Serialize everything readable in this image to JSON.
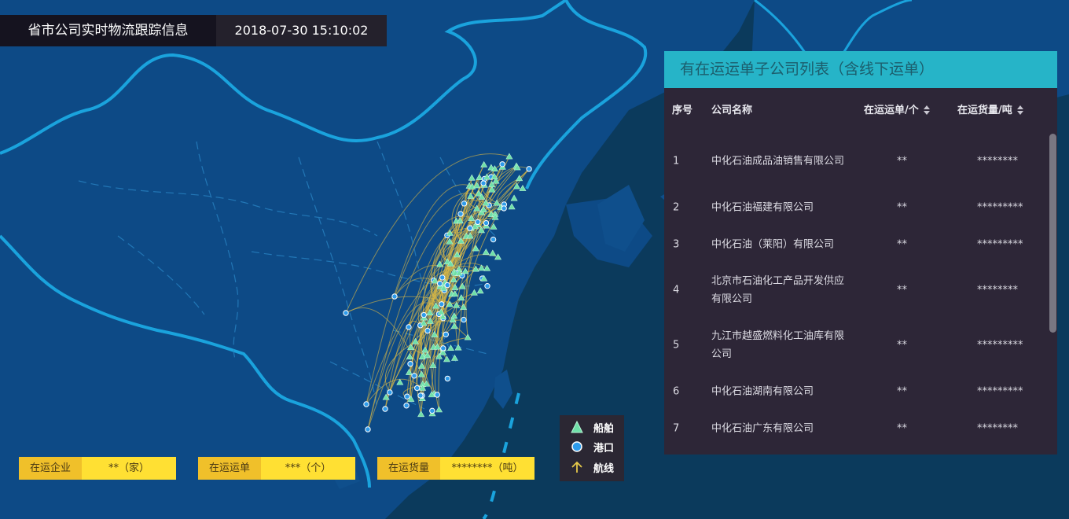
{
  "header": {
    "title": "省市公司实时物流跟踪信息",
    "datetime": "2018-07-30 15:10:02"
  },
  "panel": {
    "title": "有在运运单子公司列表（含线下运单）",
    "columns": {
      "index": "序号",
      "company": "公司名称",
      "orders": "在运运单/个",
      "volume": "在运货量/吨"
    },
    "rows": [
      {
        "index": "1",
        "company": "中化石油成品油销售有限公司",
        "orders": "**",
        "volume": "********"
      },
      {
        "index": "2",
        "company": "中化石油福建有限公司",
        "orders": "**",
        "volume": "*********"
      },
      {
        "index": "3",
        "company": "中化石油（莱阳）有限公司",
        "orders": "**",
        "volume": "*********"
      },
      {
        "index": "4",
        "company": "北京市石油化工产品开发供应有限公司",
        "orders": "**",
        "volume": "********"
      },
      {
        "index": "5",
        "company": "九江市越盛燃料化工油库有限公司",
        "orders": "**",
        "volume": "*********"
      },
      {
        "index": "6",
        "company": "中化石油湖南有限公司",
        "orders": "**",
        "volume": "*********"
      },
      {
        "index": "7",
        "company": "中化石油广东有限公司",
        "orders": "**",
        "volume": "********"
      }
    ]
  },
  "legend": {
    "ship": "船舶",
    "port": "港口",
    "route": "航线"
  },
  "stats": {
    "companies": {
      "label": "在运企业",
      "value": "**（家）"
    },
    "orders": {
      "label": "在运运单",
      "value": "***（个）"
    },
    "volume": {
      "label": "在运货量",
      "value": "********（吨）"
    }
  },
  "colors": {
    "land": "#0d4a86",
    "sea": "#0b3a5c",
    "border": "#1aa3dd",
    "panel_header": "#26b4c8",
    "panel_bg": "#2d2637",
    "ship": "#6fe0a8",
    "port": "#2e9bea",
    "route": "#d8b846",
    "stat_label": "#f0c02a",
    "stat_value": "#ffe033"
  }
}
